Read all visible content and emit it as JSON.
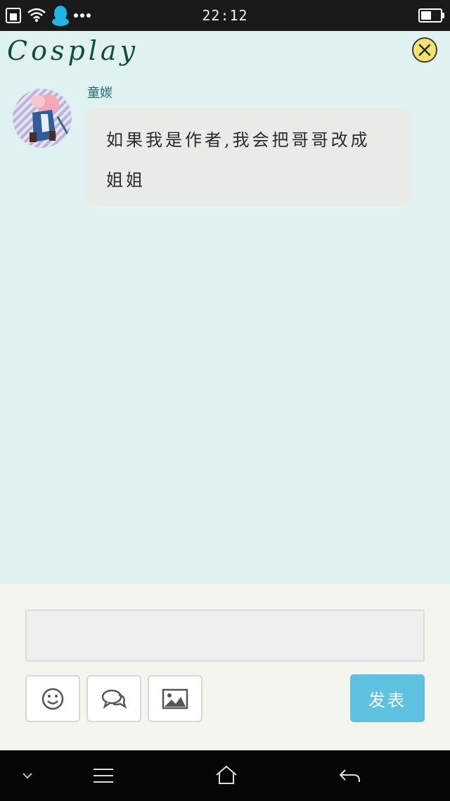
{
  "status_bar": {
    "time": "22:12",
    "icons": [
      "sim-icon",
      "wifi-icon",
      "qq-icon",
      "more-dots-icon",
      "battery-icon"
    ]
  },
  "header": {
    "title": "Cosplay",
    "close_icon": "close-icon"
  },
  "message": {
    "sender": "童㛶",
    "text": "如果我是作者,我会把哥哥改成姐姐"
  },
  "composer": {
    "input_value": "",
    "tools": [
      "emoji-icon",
      "chat-bubbles-icon",
      "image-icon"
    ],
    "send_label": "发表"
  },
  "nav_bar": {
    "buttons": [
      "chevron-down-icon",
      "menu-icon",
      "home-icon",
      "back-icon"
    ]
  },
  "colors": {
    "background": "#dff1f0",
    "title": "#0f4d3c",
    "close_button": "#f4e46c",
    "bubble": "#e9ebe6",
    "send_button": "#5ec1df",
    "panel": "#f4f5ee"
  }
}
